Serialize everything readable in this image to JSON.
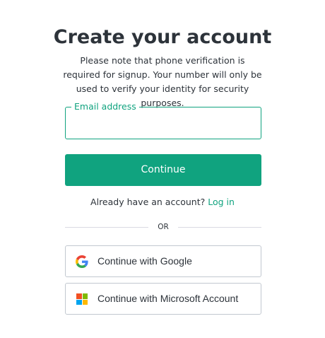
{
  "header": {
    "title": "Create your account",
    "subtitle": "Please note that phone verification is required for signup. Your number will only be used to verify your identity for security purposes."
  },
  "email": {
    "label": "Email address",
    "value": "",
    "placeholder": ""
  },
  "continue_button": {
    "label": "Continue"
  },
  "login_prompt": {
    "text": "Already have an account?",
    "link": "Log in"
  },
  "divider": {
    "text": "OR"
  },
  "social": {
    "google": {
      "label": "Continue with Google",
      "icon": "google-icon"
    },
    "microsoft": {
      "label": "Continue with Microsoft Account",
      "icon": "microsoft-icon"
    }
  },
  "colors": {
    "accent": "#10a37f",
    "text": "#2d333a",
    "border": "#c2c8d0",
    "google_blue": "#4285F4",
    "google_red": "#EA4335",
    "google_yellow": "#FBBC05",
    "google_green": "#34A853",
    "ms_red": "#F25022",
    "ms_green": "#7FBA00",
    "ms_blue": "#00A4EF",
    "ms_yellow": "#FFB900"
  }
}
